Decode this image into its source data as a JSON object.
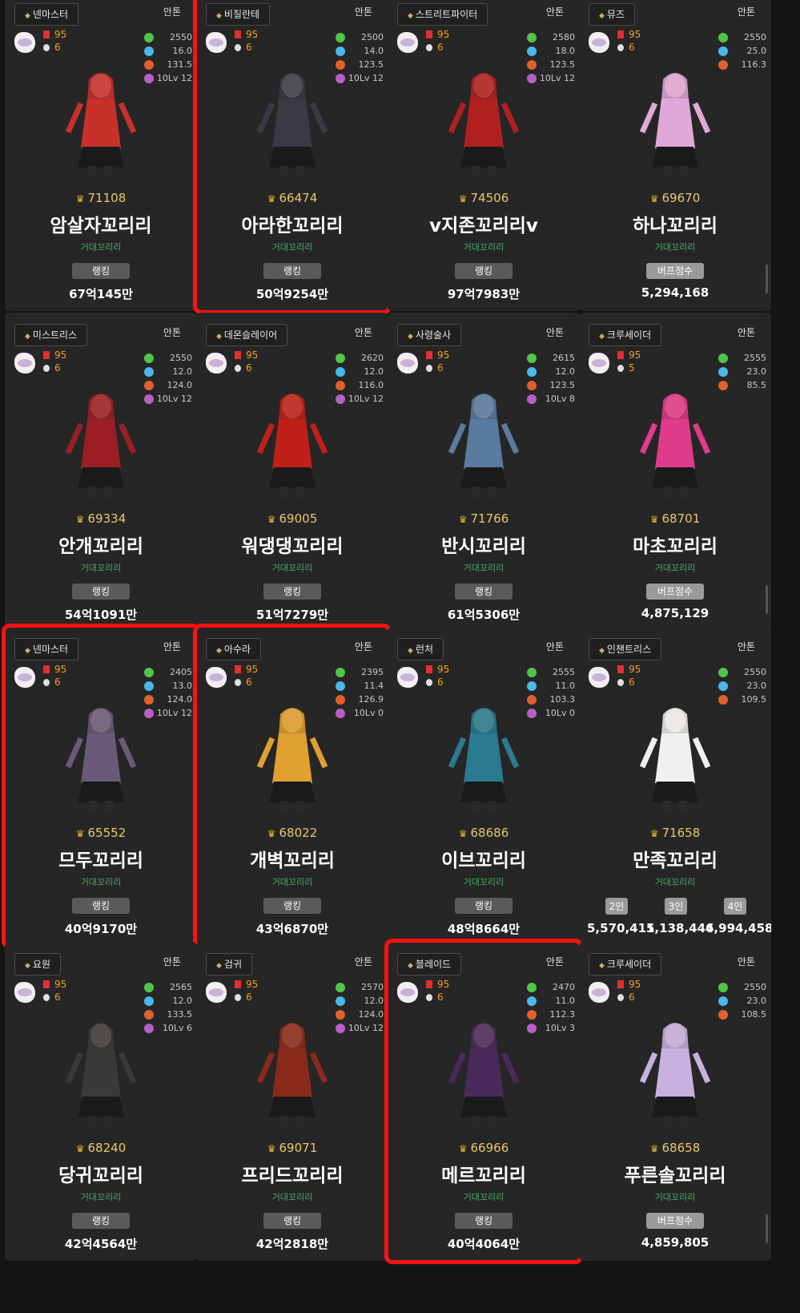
{
  "cards": [
    {
      "job": "넨마스터",
      "server": "안톤",
      "level": "95",
      "level2": "6",
      "stats": [
        "2550",
        "16.0",
        "131.5",
        "10Lv 12"
      ],
      "score": "71108",
      "name": "암살자꼬리리",
      "guild": "거대꼬리리",
      "pill": "랭킹",
      "value": "67억145만",
      "accent": "#c8302a"
    },
    {
      "job": "비질란테",
      "server": "안톤",
      "level": "95",
      "level2": "6",
      "stats": [
        "2500",
        "14.0",
        "123.5",
        "10Lv 12"
      ],
      "score": "66474",
      "name": "아라한꼬리리",
      "guild": "거대꼬리리",
      "pill": "랭킹",
      "value": "50억9254만",
      "accent": "#3a3a44"
    },
    {
      "job": "스트리트파이터",
      "server": "안톤",
      "level": "95",
      "level2": "6",
      "stats": [
        "2580",
        "18.0",
        "123.5",
        "10Lv 12"
      ],
      "score": "74506",
      "name": "v지존꼬리리v",
      "guild": "거대꼬리리",
      "pill": "랭킹",
      "value": "97억7983만",
      "accent": "#b02020"
    },
    {
      "job": "뮤즈",
      "server": "안톤",
      "level": "95",
      "level2": "6",
      "stats": [
        "2550",
        "25.0",
        "116.3"
      ],
      "score": "69670",
      "name": "하나꼬리리",
      "guild": "거대꼬리리",
      "pill": "버프점수",
      "value": "5,294,168",
      "accent": "#e0a8d8"
    },
    {
      "job": "미스트리스",
      "server": "안톤",
      "level": "95",
      "level2": "6",
      "stats": [
        "2550",
        "12.0",
        "124.0",
        "10Lv 12"
      ],
      "score": "69334",
      "name": "안개꼬리리",
      "guild": "거대꼬리리",
      "pill": "랭킹",
      "value": "54억1091만",
      "accent": "#9a1e24"
    },
    {
      "job": "데몬슬레이어",
      "server": "안톤",
      "level": "95",
      "level2": "6",
      "stats": [
        "2620",
        "12.0",
        "116.0",
        "10Lv 12"
      ],
      "score": "69005",
      "name": "워댕댕꼬리리",
      "guild": "거대꼬리리",
      "pill": "랭킹",
      "value": "51억7279만",
      "accent": "#c02018"
    },
    {
      "job": "사령술사",
      "server": "안톤",
      "level": "95",
      "level2": "6",
      "stats": [
        "2615",
        "12.0",
        "123.5",
        "10Lv 8"
      ],
      "score": "71766",
      "name": "반시꼬리리",
      "guild": "거대꼬리리",
      "pill": "랭킹",
      "value": "61억5306만",
      "accent": "#5a7aa0"
    },
    {
      "job": "크루세이더",
      "server": "안톤",
      "level": "95",
      "level2": "5",
      "stats": [
        "2555",
        "23.0",
        "85.5"
      ],
      "score": "68701",
      "name": "마초꼬리리",
      "guild": "거대꼬리리",
      "pill": "버프점수",
      "value": "4,875,129",
      "accent": "#e03a8a"
    },
    {
      "job": "넨마스터",
      "server": "안톤",
      "level": "95",
      "level2": "6",
      "stats": [
        "2405",
        "13.0",
        "124.0",
        "10Lv 12"
      ],
      "score": "65552",
      "name": "므두꼬리리",
      "guild": "거대꼬리리",
      "pill": "랭킹",
      "value": "40억9170만",
      "accent": "#6a5a7a"
    },
    {
      "job": "아수라",
      "server": "안톤",
      "level": "95",
      "level2": "6",
      "stats": [
        "2395",
        "11.4",
        "126.9",
        "10Lv 0"
      ],
      "score": "68022",
      "name": "개벽꼬리리",
      "guild": "거대꼬리리",
      "pill": "랭킹",
      "value": "43억6870만",
      "accent": "#e0a030"
    },
    {
      "job": "런처",
      "server": "안톤",
      "level": "95",
      "level2": "6",
      "stats": [
        "2555",
        "11.0",
        "103.3",
        "10Lv 0"
      ],
      "score": "68686",
      "name": "이브꼬리리",
      "guild": "거대꼬리리",
      "pill": "랭킹",
      "value": "48억8664만",
      "accent": "#2a7a90"
    },
    {
      "job": "인챈트리스",
      "server": "안톤",
      "level": "95",
      "level2": "6",
      "stats": [
        "2550",
        "23.0",
        "109.5"
      ],
      "score": "71658",
      "name": "만족꼬리리",
      "guild": "거대꼬리리",
      "ranks": [
        {
          "label": "2인",
          "value": "5,570,411"
        },
        {
          "label": "3인",
          "value": "5,138,446"
        },
        {
          "label": "4인",
          "value": "4,994,458"
        }
      ],
      "accent": "#f0f0f0"
    },
    {
      "job": "요원",
      "server": "안톤",
      "level": "95",
      "level2": "6",
      "stats": [
        "2565",
        "12.0",
        "133.5",
        "10Lv 6"
      ],
      "score": "68240",
      "name": "당귀꼬리리",
      "guild": "거대꼬리리",
      "pill": "랭킹",
      "value": "42억4564만",
      "accent": "#3a3a3a"
    },
    {
      "job": "검귀",
      "server": "안톤",
      "level": "95",
      "level2": "6",
      "stats": [
        "2570",
        "12.0",
        "124.0",
        "10Lv 12"
      ],
      "score": "69071",
      "name": "프리드꼬리리",
      "guild": "거대꼬리리",
      "pill": "랭킹",
      "value": "42억2818만",
      "accent": "#8a2a1a"
    },
    {
      "job": "블레이드",
      "server": "안톤",
      "level": "95",
      "level2": "6",
      "stats": [
        "2470",
        "11.0",
        "112.3",
        "10Lv 3"
      ],
      "score": "66966",
      "name": "메르꼬리리",
      "guild": "거대꼬리리",
      "pill": "랭킹",
      "value": "40억4064만",
      "accent": "#4a2a5a"
    },
    {
      "job": "크루세이더",
      "server": "안톤",
      "level": "95",
      "level2": "6",
      "stats": [
        "2550",
        "23.0",
        "108.5"
      ],
      "score": "68658",
      "name": "푸른솔꼬리리",
      "guild": "거대꼬리리",
      "pill": "버프점수",
      "value": "4,859,805",
      "accent": "#c8b0e0"
    }
  ]
}
